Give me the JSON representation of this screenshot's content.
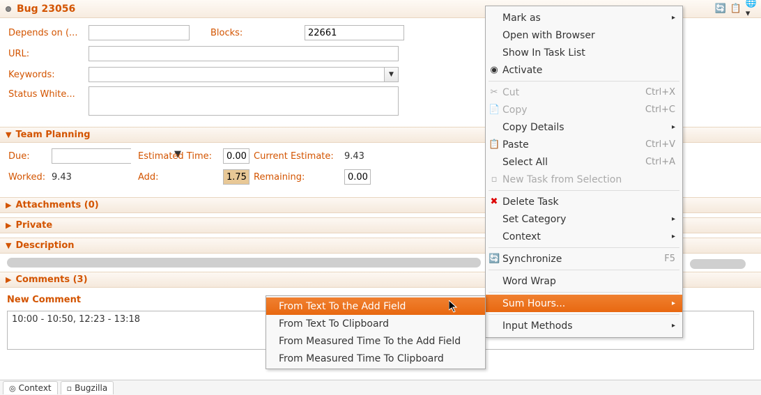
{
  "title": "Bug 23056",
  "fields": {
    "depends_on_label": "Depends on (...",
    "depends_on_value": "",
    "blocks_label": "Blocks:",
    "blocks_value": "22661",
    "url_label": "URL:",
    "url_value": "",
    "keywords_label": "Keywords:",
    "keywords_value": "",
    "status_white_label": "Status White..."
  },
  "team_planning": {
    "header": "Team Planning",
    "due_label": "Due:",
    "estimated_time_label": "Estimated Time:",
    "estimated_time_value": "0.00",
    "current_estimate_label": "Current Estimate:",
    "current_estimate_value": "9.43",
    "worked_label": "Worked:",
    "worked_value": "9.43",
    "add_label": "Add:",
    "add_value": "1.75",
    "remaining_label": "Remaining:",
    "remaining_value": "0.00"
  },
  "sections": {
    "attachments": "Attachments (0)",
    "private": "Private",
    "description": "Description",
    "comments": "Comments (3)",
    "new_comment": "New Comment"
  },
  "comment_text": "10:00 - 10:50, 12:23 - 13:18",
  "tabs": {
    "context": "Context",
    "bugzilla": "Bugzilla"
  },
  "menu": {
    "mark_as": "Mark as",
    "open_browser": "Open with Browser",
    "show_task_list": "Show In Task List",
    "activate": "Activate",
    "cut": "Cut",
    "cut_key": "Ctrl+X",
    "copy": "Copy",
    "copy_key": "Ctrl+C",
    "copy_details": "Copy Details",
    "paste": "Paste",
    "paste_key": "Ctrl+V",
    "select_all": "Select All",
    "select_all_key": "Ctrl+A",
    "new_task": "New Task from Selection",
    "delete_task": "Delete Task",
    "set_category": "Set Category",
    "context": "Context",
    "synchronize": "Synchronize",
    "synchronize_key": "F5",
    "word_wrap": "Word Wrap",
    "sum_hours": "Sum Hours...",
    "input_methods": "Input Methods"
  },
  "submenu": {
    "to_add": "From Text To the Add Field",
    "to_clipboard": "From Text To Clipboard",
    "measured_add": "From Measured Time To the Add Field",
    "measured_clip": "From Measured Time To Clipboard"
  }
}
